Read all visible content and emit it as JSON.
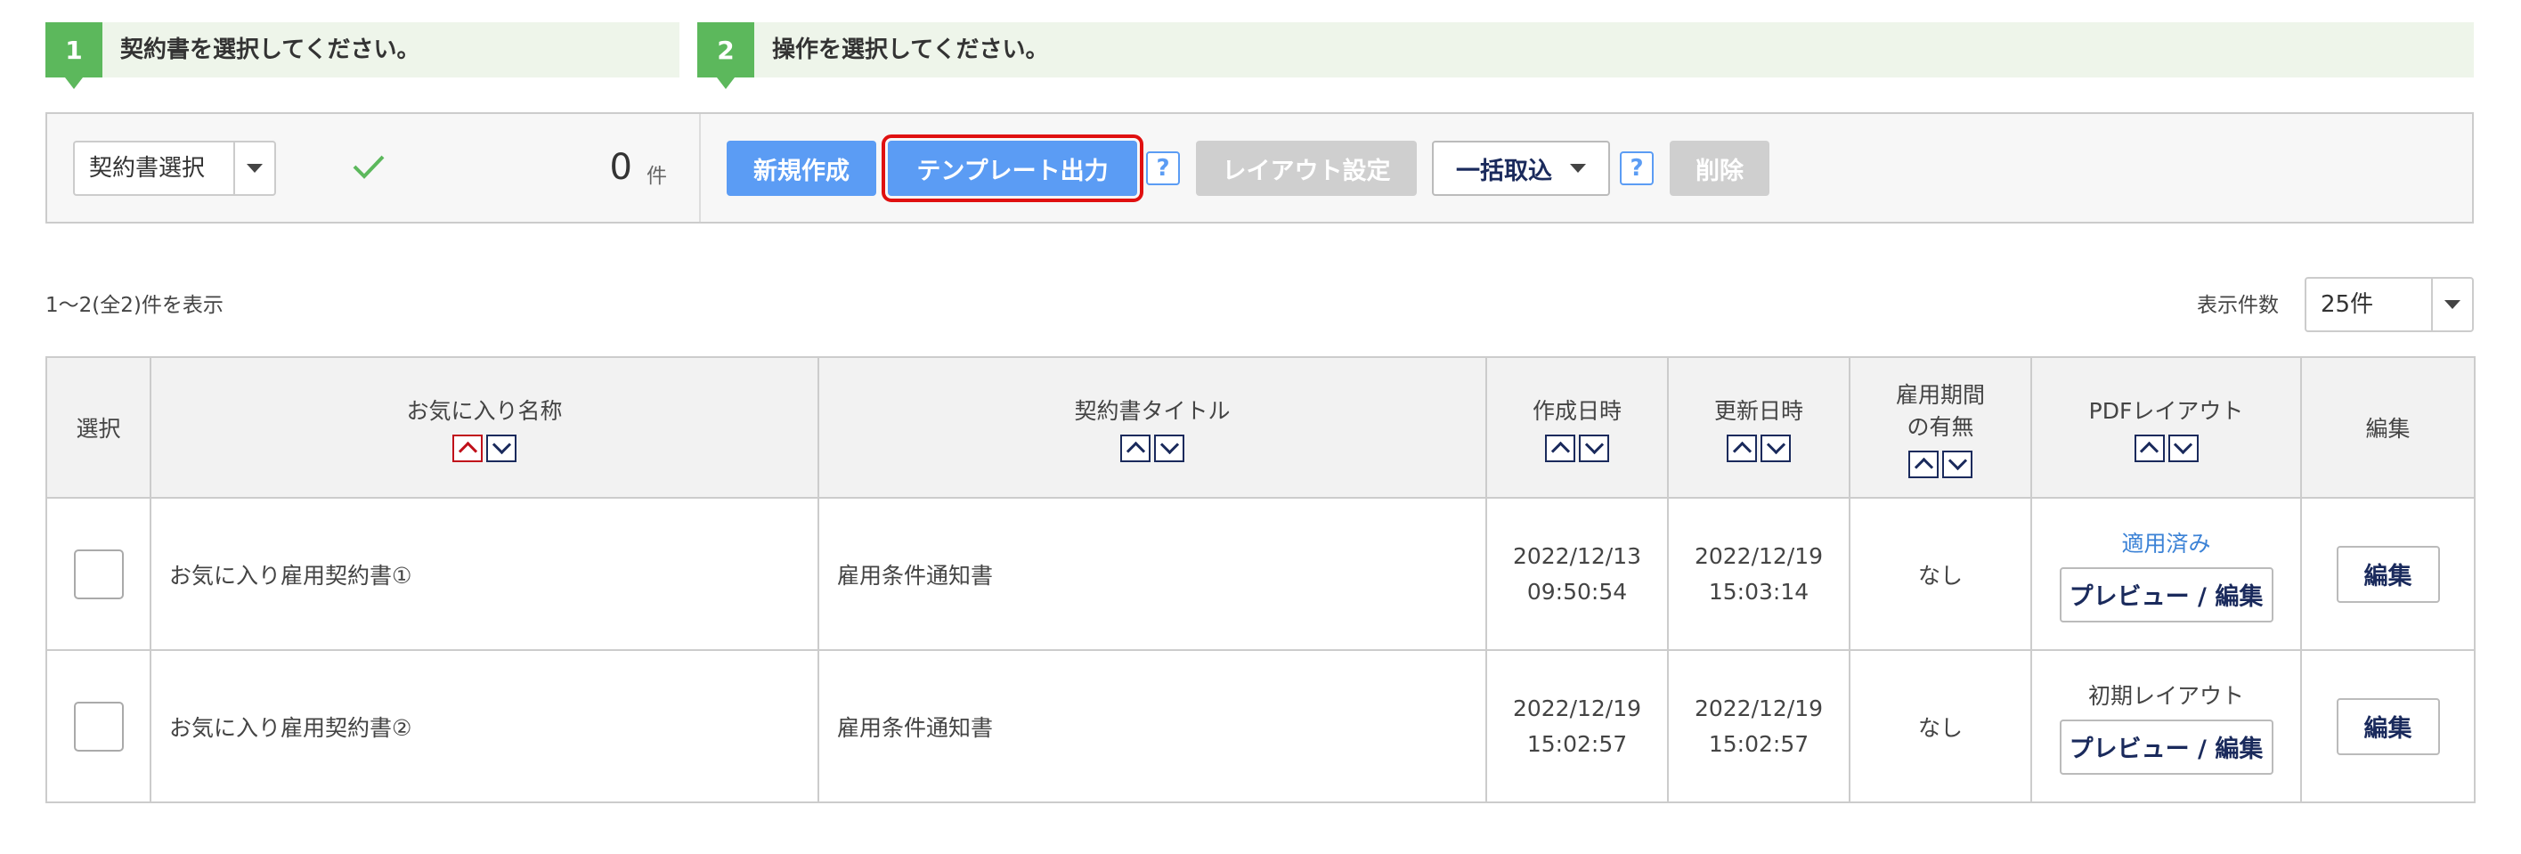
{
  "steps": [
    {
      "number": "1",
      "text": "契約書を選択してください。"
    },
    {
      "number": "2",
      "text": "操作を選択してください。"
    }
  ],
  "toolbar": {
    "select_label": "契約書選択",
    "count_value": "0",
    "count_unit": "件",
    "new_label": "新規作成",
    "template_label": "テンプレート出力",
    "help_label": "?",
    "layout_label": "レイアウト設定",
    "bulk_label": "一括取込",
    "delete_label": "削除"
  },
  "list_info": {
    "range_text": "1〜2(全2)件を表示",
    "per_page_label": "表示件数",
    "per_page_value": "25件"
  },
  "table": {
    "headers": {
      "select": "選択",
      "favorite_name": "お気に入り名称",
      "contract_title": "契約書タイトル",
      "created": "作成日時",
      "updated": "更新日時",
      "period_line1": "雇用期間",
      "period_line2": "の有無",
      "pdf_layout": "PDFレイアウト",
      "edit": "編集"
    },
    "rows": [
      {
        "favorite_name": "お気に入り雇用契約書①",
        "contract_title": "雇用条件通知書",
        "created_date": "2022/12/13",
        "created_time": "09:50:54",
        "updated_date": "2022/12/19",
        "updated_time": "15:03:14",
        "period": "なし",
        "pdf_status": "適用済み",
        "preview_label": "プレビュー / 編集",
        "edit_label": "編集"
      },
      {
        "favorite_name": "お気に入り雇用契約書②",
        "contract_title": "雇用条件通知書",
        "created_date": "2022/12/19",
        "created_time": "15:02:57",
        "updated_date": "2022/12/19",
        "updated_time": "15:02:57",
        "period": "なし",
        "pdf_status": "初期レイアウト",
        "preview_label": "プレビュー / 編集",
        "edit_label": "編集"
      }
    ]
  },
  "colors": {
    "step_green": "#5cb85c",
    "primary_blue": "#5b9cf4",
    "disabled_gray": "#cfcfcf",
    "highlight_red": "#e01010",
    "navy_text": "#1a2a5c",
    "link_blue": "#3b82d6"
  },
  "icons": {
    "check": "check-icon",
    "caret": "chevron-down-icon",
    "sort_up": "sort-asc-icon",
    "sort_down": "sort-desc-icon"
  }
}
